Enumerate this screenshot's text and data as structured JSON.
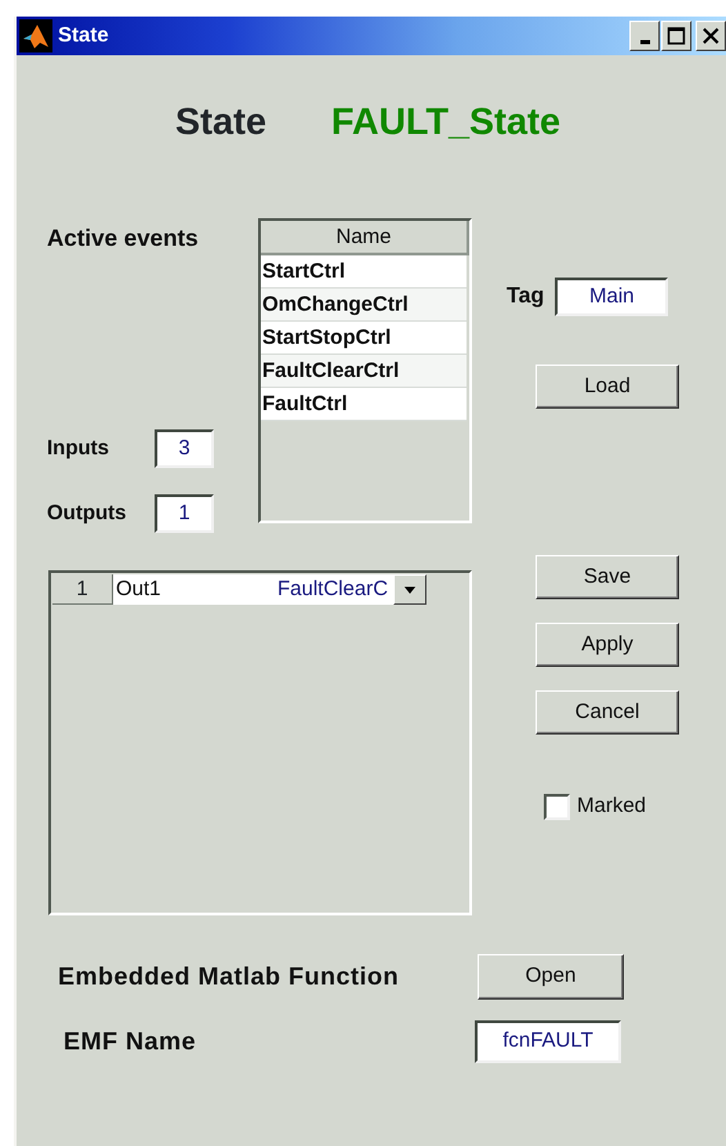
{
  "window": {
    "title": "State"
  },
  "heading": {
    "label": "State",
    "value": "FAULT_State"
  },
  "active_events": {
    "label": "Active events",
    "column": "Name",
    "items": [
      {
        "name": "StartCtrl"
      },
      {
        "name": "OmChangeCtrl"
      },
      {
        "name": "StartStopCtrl"
      },
      {
        "name": "FaultClearCtrl"
      },
      {
        "name": "FaultCtrl"
      }
    ]
  },
  "tag": {
    "label": "Tag",
    "value": "Main"
  },
  "load_button": "Load",
  "inputs": {
    "label": "Inputs",
    "value": "3"
  },
  "outputs": {
    "label": "Outputs",
    "value": "1"
  },
  "output_table": {
    "rows": [
      {
        "index": "1",
        "name": "Out1",
        "event": "FaultClearC"
      }
    ]
  },
  "actions": [
    "Save",
    "Apply",
    "Cancel"
  ],
  "marked": {
    "label": "Marked",
    "checked": false
  },
  "emf": {
    "label": "Embedded Matlab Function",
    "button": "Open",
    "name_label": "EMF Name",
    "name_value": "fcnFAULT"
  }
}
